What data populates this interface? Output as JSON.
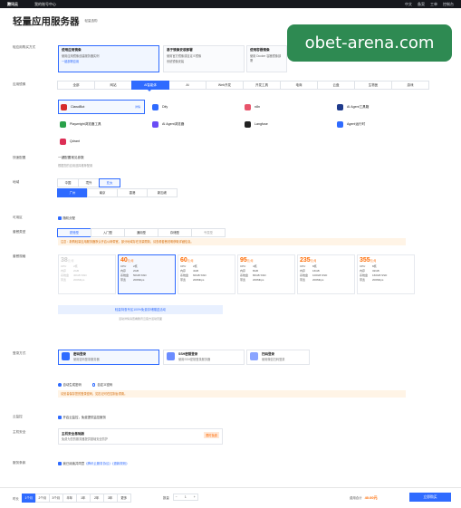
{
  "topbar": {
    "logo": "腾讯云",
    "console": "我的账号中心",
    "links": [
      "中文",
      "备案",
      "工单",
      "控制台"
    ]
  },
  "header": {
    "title": "轻量应用服务器",
    "doc_link": "轻量选购"
  },
  "watermark": "obet-arena.com",
  "labels": {
    "mode": "轻应用购买方式",
    "image": "应用镜像",
    "quickstart": "快速配置",
    "region": "地域",
    "az": "可用区",
    "package_type": "套餐类型",
    "package_spec": "套餐规格",
    "login": "登录方式",
    "cloud_monitor": "云监控",
    "protection": "主机安全",
    "tos": "服务条款"
  },
  "mode_cards": [
    {
      "title": "使用应用镜像",
      "line1": "使用应用镜像创建服务器实例",
      "line2": "一键部署应用"
    },
    {
      "title": "基于镜像安装部署",
      "line1": "使用官方镜像或自定义镜像",
      "line2": "系统镜像安装"
    },
    {
      "title": "使用容器镜像",
      "line1": "使用 Docker 容器镜像部署",
      "line2": "支持多种容器编排"
    }
  ],
  "image_tabs": [
    "全部",
    "网站",
    "AI智能体",
    "AI",
    "Web开发",
    "开发工具",
    "电商",
    "云盘",
    "生物医",
    "游戏"
  ],
  "apps": [
    {
      "name": "ClawdBot",
      "sub": "详情"
    },
    {
      "name": "Dify"
    },
    {
      "name": "n8n"
    },
    {
      "name": "AI Agent工具箱"
    },
    {
      "name": "Playwright浏览器工具"
    },
    {
      "name": "AI Agent浏览器"
    },
    {
      "name": "Langfuse"
    },
    {
      "name": "Agent运行时"
    },
    {
      "name": "Qdrant"
    }
  ],
  "quickstart": {
    "text": "一键配置常见参数",
    "hint": "根据您的应用选择推荐配置"
  },
  "region": {
    "tabs": [
      "中国",
      "境外",
      "亚太"
    ],
    "sub": [
      "广州",
      "上海",
      "北京"
    ],
    "selected": "广州",
    "sub_cities": [
      "广州",
      "南京",
      "香港",
      "新加坡"
    ]
  },
  "az": {
    "text": "随机分配"
  },
  "package_types": [
    "锐驰型",
    "入门型",
    "通用型",
    "存储型",
    "专属型"
  ],
  "notice": "注意：新购轻量应用服务器默认开启公网带宽，部分地域存在流量限制，请查看套餐说明获取详细信息。",
  "specs": [
    {
      "price": "38",
      "unit": "元/月",
      "cpu": "2核",
      "mem": "2GB",
      "disk": "40GB SSD",
      "bw": "200Mbps",
      "disabled": true
    },
    {
      "price": "40",
      "unit": "元/月",
      "cpu": "2核",
      "mem": "2GB",
      "disk": "50GB SSD",
      "bw": "200Mbps",
      "disabled": false
    },
    {
      "price": "60",
      "unit": "元/月",
      "cpu": "2核",
      "mem": "4GB",
      "disk": "60GB SSD",
      "bw": "200Mbps",
      "disabled": false
    },
    {
      "price": "95",
      "unit": "元/月",
      "cpu": "4核",
      "mem": "8GB",
      "disk": "80GB SSD",
      "bw": "200Mbps",
      "disabled": false
    },
    {
      "price": "235",
      "unit": "元/月",
      "cpu": "8核",
      "mem": "16GB",
      "disk": "100GB SSD",
      "bw": "200Mbps",
      "disabled": false
    },
    {
      "price": "355",
      "unit": "元/月",
      "cpu": "8核",
      "mem": "32GB",
      "disk": "160GB SSD",
      "bw": "200Mbps",
      "disabled": false
    }
  ],
  "spec_keys": {
    "cpu": "CPU",
    "mem": "内存",
    "disk": "系统盘",
    "bw": "带宽"
  },
  "promo": {
    "text": "轻量特惠专区100%免费存储赠送活动",
    "sub": "活动详情请查看腾讯云官方活动页面"
  },
  "login_cards": [
    {
      "title": "密码登录",
      "desc": "使用密码登录服务器"
    },
    {
      "title": "SSH密钥登录",
      "desc": "使用SSH密钥登录服务器"
    },
    {
      "title": "扫码登录",
      "desc": "使用微信扫码登录"
    }
  ],
  "login_radios": [
    "自动生成密码",
    "自定义密码"
  ],
  "warn": "请妥善保存您的登录密码，如忘记可在控制台重置。",
  "cloud_monitor": "开启云监控，免费提供监控服务",
  "protection": {
    "title": "主机安全基础版",
    "desc": "免费为您的服务器提供基础安全防护",
    "badge": "限时免费"
  },
  "tos": {
    "text": "我已阅读并同意",
    "links": "《腾讯云服务协议》《退款规则》"
  },
  "footer": {
    "duration_label": "时长",
    "durations": [
      "1个月",
      "2个月",
      "3个月",
      "半年",
      "1年",
      "2年",
      "3年",
      "更多"
    ],
    "selected": "1个月",
    "qty_label": "数量",
    "qty": "1",
    "fee_label": "费用合计",
    "fee": "40.00元",
    "buy": "立即购买"
  },
  "colors": {
    "accent": "#2f6bff",
    "price": "#ff6a00",
    "topbar": "#16181d",
    "watermark": "#2e8a52"
  }
}
